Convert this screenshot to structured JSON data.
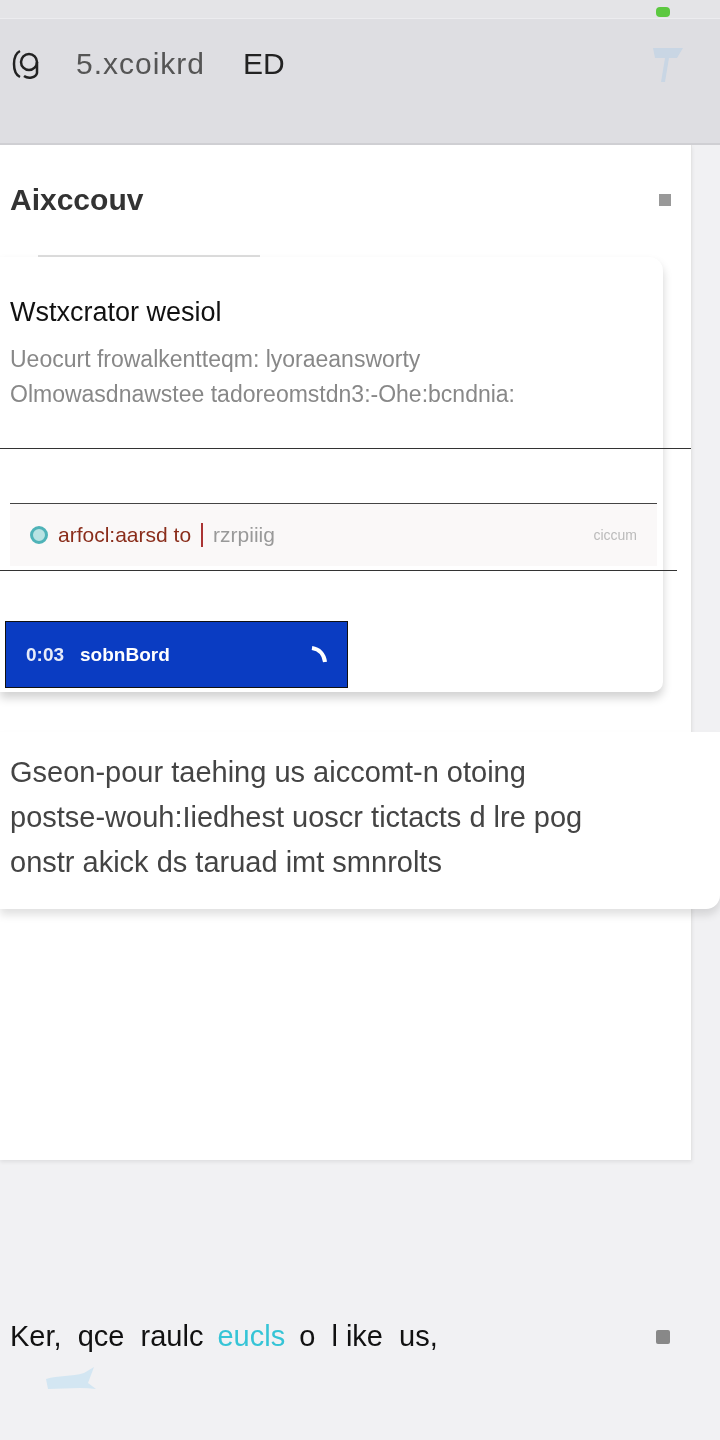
{
  "header": {
    "title": "5.xcoikrd",
    "badge": "ED"
  },
  "section": {
    "heading": "Aixccouv"
  },
  "card": {
    "title": "Wstxcrator wesiol",
    "lines": [
      "Ueocurt frowalkentteqm: lyoraeansworty",
      "Olmowasdnawstee tadoreomstdn3:-Ohe:bcndnia:"
    ],
    "field": {
      "value": "arfocl:aarsd to",
      "placeholder": "rzrpiiig",
      "aside": "ciccum"
    },
    "button": {
      "count": "0:03",
      "label": "sobnBord"
    }
  },
  "paragraph": "Gseon-pour taehing us aiccomt-n otoing postse-wouh:Iiedhest uoscr tictacts d lre pog onstr akick ds taruad imt smnrolts",
  "footer": [
    {
      "kind": "plain",
      "text": "Ker,  qce  raulc"
    },
    {
      "kind": "link",
      "text": "eucls"
    },
    {
      "kind": "plain",
      "text": "o  l ike  us,"
    }
  ]
}
